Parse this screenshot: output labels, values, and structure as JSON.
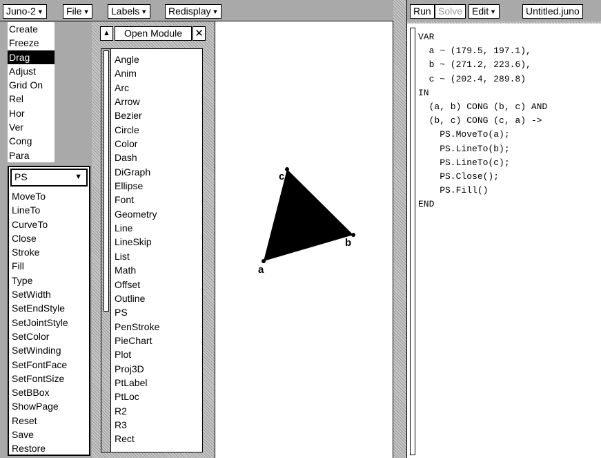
{
  "menubar": {
    "module_menu": "Juno-2",
    "file_menu": "File",
    "labels_menu": "Labels",
    "redisplay_menu": "Redisplay"
  },
  "commands": [
    "Create",
    "Freeze",
    "Drag",
    "Adjust",
    "Grid On",
    "Rel",
    "Hor",
    "Ver",
    "Cong",
    "Para"
  ],
  "selected_command": "Drag",
  "ps_module": {
    "selected": "PS",
    "procedures": [
      "MoveTo",
      "LineTo",
      "CurveTo",
      "Close",
      "Stroke",
      "Fill",
      "Type",
      "SetWidth",
      "SetEndStyle",
      "SetJointStyle",
      "SetColor",
      "SetWinding",
      "SetFontFace",
      "SetFontSize",
      "SetBBox",
      "ShowPage",
      "Reset",
      "Save",
      "Restore"
    ]
  },
  "open_module": {
    "title": "Open Module",
    "modules": [
      "Angle",
      "Anim",
      "Arc",
      "Arrow",
      "Bezier",
      "Circle",
      "Color",
      "Dash",
      "DiGraph",
      "Ellipse",
      "Font",
      "Geometry",
      "Line",
      "LineSkip",
      "List",
      "Math",
      "Offset",
      "Outline",
      "PS",
      "PenStroke",
      "PieChart",
      "Plot",
      "Proj3D",
      "PtLabel",
      "PtLoc",
      "R2",
      "R3",
      "Rect"
    ]
  },
  "canvas": {
    "fill_color": "#000000",
    "points": [
      {
        "label": "a"
      },
      {
        "label": "b"
      },
      {
        "label": "c"
      }
    ]
  },
  "editor_toolbar": {
    "run": "Run",
    "solve": "Solve",
    "edit": "Edit",
    "filename": "Untitled.juno"
  },
  "editor": {
    "code_lines": [
      "VAR",
      "  a ~ (179.5, 197.1),",
      "  b ~ (271.2, 223.6),",
      "  c ~ (202.4, 289.8)",
      "IN",
      "  (a, b) CONG (b, c) AND",
      "  (b, c) CONG (c, a) ->",
      "    PS.MoveTo(a);",
      "    PS.LineTo(b);",
      "    PS.LineTo(c);",
      "    PS.Close();",
      "    PS.Fill()",
      "END"
    ]
  }
}
